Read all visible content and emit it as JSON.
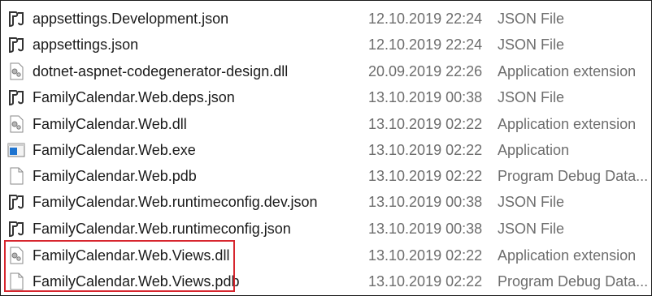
{
  "files": [
    {
      "name": "appsettings.Development.json",
      "date": "12.10.2019 22:24",
      "type": "JSON File",
      "icon": "json-file-icon"
    },
    {
      "name": "appsettings.json",
      "date": "12.10.2019 22:24",
      "type": "JSON File",
      "icon": "json-file-icon"
    },
    {
      "name": "dotnet-aspnet-codegenerator-design.dll",
      "date": "20.09.2019 22:26",
      "type": "Application extension",
      "icon": "dll-file-icon"
    },
    {
      "name": "FamilyCalendar.Web.deps.json",
      "date": "13.10.2019 00:38",
      "type": "JSON File",
      "icon": "json-file-icon"
    },
    {
      "name": "FamilyCalendar.Web.dll",
      "date": "13.10.2019 02:22",
      "type": "Application extension",
      "icon": "dll-file-icon"
    },
    {
      "name": "FamilyCalendar.Web.exe",
      "date": "13.10.2019 02:22",
      "type": "Application",
      "icon": "exe-file-icon"
    },
    {
      "name": "FamilyCalendar.Web.pdb",
      "date": "13.10.2019 02:22",
      "type": "Program Debug Data...",
      "icon": "blank-file-icon"
    },
    {
      "name": "FamilyCalendar.Web.runtimeconfig.dev.json",
      "date": "13.10.2019 00:38",
      "type": "JSON File",
      "icon": "json-file-icon"
    },
    {
      "name": "FamilyCalendar.Web.runtimeconfig.json",
      "date": "13.10.2019 00:38",
      "type": "JSON File",
      "icon": "json-file-icon"
    },
    {
      "name": "FamilyCalendar.Web.Views.dll",
      "date": "13.10.2019 02:22",
      "type": "Application extension",
      "icon": "dll-file-icon"
    },
    {
      "name": "FamilyCalendar.Web.Views.pdb",
      "date": "13.10.2019 02:22",
      "type": "Program Debug Data...",
      "icon": "blank-file-icon"
    }
  ],
  "colors": {
    "highlight": "#d7262e",
    "text": "#1b1b1b",
    "meta": "#6d6d6d"
  }
}
